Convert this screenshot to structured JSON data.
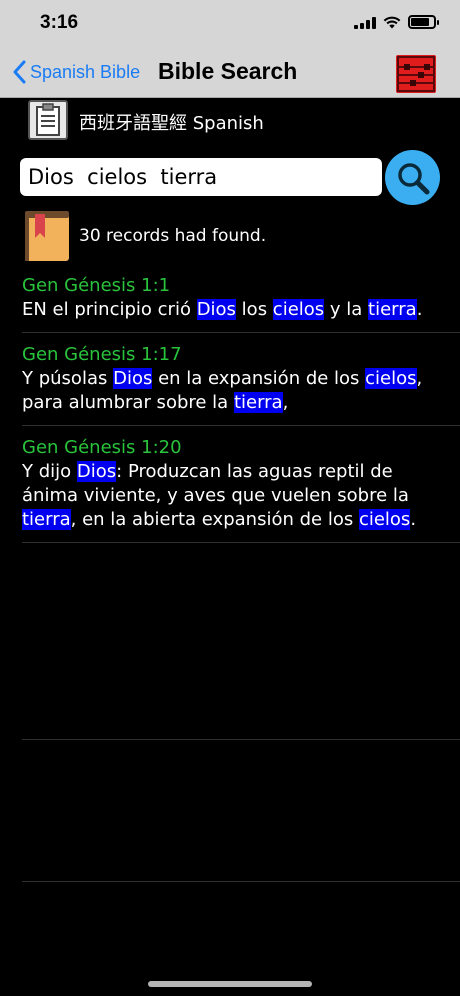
{
  "status": {
    "time": "3:16"
  },
  "nav": {
    "back_label": "Spanish Bible",
    "title": "Bible Search"
  },
  "language": {
    "label": "西班牙語聖經 Spanish"
  },
  "search": {
    "value": "Dios  cielos  tierra"
  },
  "results": {
    "count_text": "30 records had found."
  },
  "verses": [
    {
      "ref": "Gen Génesis 1:1",
      "segments": [
        {
          "t": "EN el principio crió ",
          "hl": false
        },
        {
          "t": "Dios",
          "hl": true
        },
        {
          "t": " los ",
          "hl": false
        },
        {
          "t": "cielos",
          "hl": true
        },
        {
          "t": " y la ",
          "hl": false
        },
        {
          "t": "tierra",
          "hl": true
        },
        {
          "t": ".",
          "hl": false
        }
      ]
    },
    {
      "ref": "Gen Génesis 1:17",
      "segments": [
        {
          "t": "Y púsolas ",
          "hl": false
        },
        {
          "t": "Dios",
          "hl": true
        },
        {
          "t": " en la expansión de los ",
          "hl": false
        },
        {
          "t": "cielos",
          "hl": true
        },
        {
          "t": ", para alumbrar sobre la ",
          "hl": false
        },
        {
          "t": "tierra",
          "hl": true
        },
        {
          "t": ",",
          "hl": false
        }
      ]
    },
    {
      "ref": "Gen Génesis 1:20",
      "segments": [
        {
          "t": "Y dijo ",
          "hl": false
        },
        {
          "t": "Dios",
          "hl": true
        },
        {
          "t": ": Produzcan las aguas reptil de ánima viviente, y aves que vuelen sobre la ",
          "hl": false
        },
        {
          "t": "tierra",
          "hl": true
        },
        {
          "t": ", en la abierta expansión de los ",
          "hl": false
        },
        {
          "t": "cielos",
          "hl": true
        },
        {
          "t": ".",
          "hl": false
        }
      ]
    }
  ],
  "colors": {
    "accent": "#1a7cf5",
    "reference_green": "#29c43c",
    "highlight": "#0000f0",
    "search_button": "#3aaef0"
  },
  "icons": {
    "nav_right": "red-abacus-icon",
    "language": "clipboard-icon",
    "search": "magnifier-icon",
    "results": "book-bookmark-icon"
  }
}
